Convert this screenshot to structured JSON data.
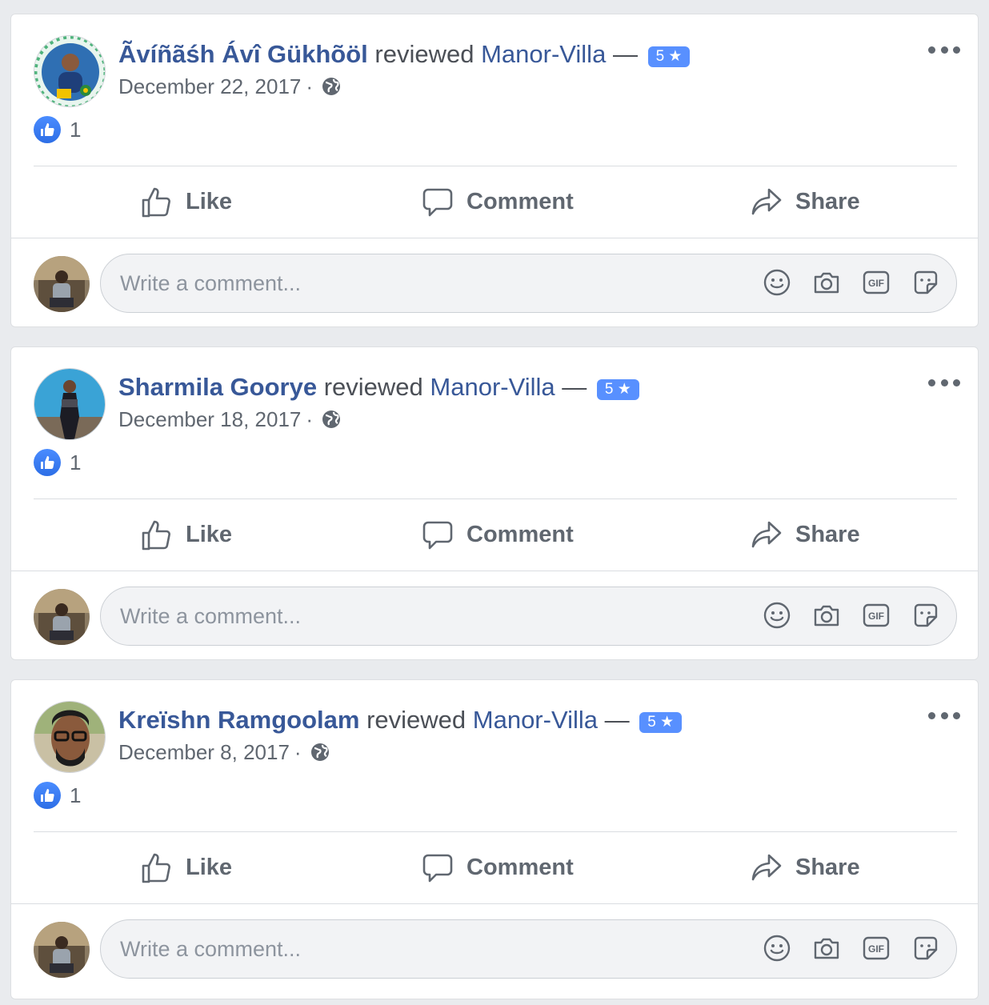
{
  "reviews": [
    {
      "author": "Ãvíñãśh Ávî Gükhõöl",
      "verb": "reviewed",
      "page": "Manor-Villa",
      "dash": "—",
      "rating": "5 ★",
      "date": "December 22, 2017",
      "separator": "·",
      "privacy_icon": "globe-icon",
      "like_count": "1"
    },
    {
      "author": "Sharmila Goorye",
      "verb": "reviewed",
      "page": "Manor-Villa",
      "dash": "—",
      "rating": "5 ★",
      "date": "December 18, 2017",
      "separator": "·",
      "privacy_icon": "globe-icon",
      "like_count": "1"
    },
    {
      "author": "Kreïshn Ramgoolam",
      "verb": "reviewed",
      "page": "Manor-Villa",
      "dash": "—",
      "rating": "5 ★",
      "date": "December 8, 2017",
      "separator": "·",
      "privacy_icon": "globe-icon",
      "like_count": "1"
    }
  ],
  "actions": {
    "like": "Like",
    "comment": "Comment",
    "share": "Share"
  },
  "comment_box": {
    "placeholder": "Write a comment...",
    "icons": [
      "emoji-icon",
      "camera-icon",
      "gif-icon",
      "sticker-icon"
    ]
  },
  "colors": {
    "link": "#385898",
    "badge": "#5890ff",
    "background": "#e9ebee"
  }
}
